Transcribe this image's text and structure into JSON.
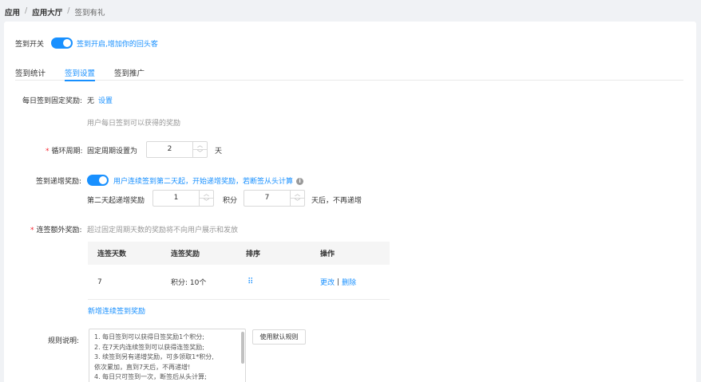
{
  "breadcrumb": {
    "items": [
      "应用",
      "应用大厅",
      "签到有礼"
    ]
  },
  "signin_switch": {
    "label": "签到开关",
    "hint": "签到开启,增加你的回头客",
    "on": true
  },
  "tabs": [
    {
      "label": "签到统计",
      "active": false
    },
    {
      "label": "签到设置",
      "active": true
    },
    {
      "label": "签到推广",
      "active": false
    }
  ],
  "daily_reward": {
    "label": "每日签到固定奖励:",
    "value": "无",
    "link": "设置",
    "hint": "用户每日签到可以获得的奖励"
  },
  "cycle": {
    "required": "*",
    "label": "循环周期:",
    "prefix": "固定周期设置为",
    "value": "2",
    "unit": "天"
  },
  "increment": {
    "label": "签到递增奖励:",
    "on": true,
    "hint": "用户连续签到第二天起，开始递增奖励，若断签从头计算",
    "row_prefix": "第二天起递增奖励",
    "value1": "1",
    "unit1": "积分",
    "value2": "7",
    "suffix": "天后，不再递增"
  },
  "extra_reward": {
    "required": "*",
    "label": "连签额外奖励:",
    "hint": "超过固定周期天数的奖励将不向用户展示和发放",
    "columns": [
      "连签天数",
      "连签奖励",
      "排序",
      "操作"
    ],
    "rows": [
      {
        "days": "7",
        "reward": "积分: 10个",
        "edit": "更改",
        "sep": "|",
        "delete": "删除"
      }
    ],
    "add_link": "新增连续签到奖励"
  },
  "rules": {
    "label": "规则说明:",
    "lines": [
      "1. 每日签到可以获得日签奖励1个积分;",
      "2. 在7天内连续签到可以获得连签奖励;",
      "3. 续签到另有递增奖励，可多领取1*积分,",
      "依次累加，直到7天后，不再递增!",
      "4. 每日只可签到一次，断签后从头计算;"
    ],
    "default_button": "使用默认规则"
  },
  "colors": {
    "accent": "#1890ff",
    "required": "#f5222d"
  }
}
